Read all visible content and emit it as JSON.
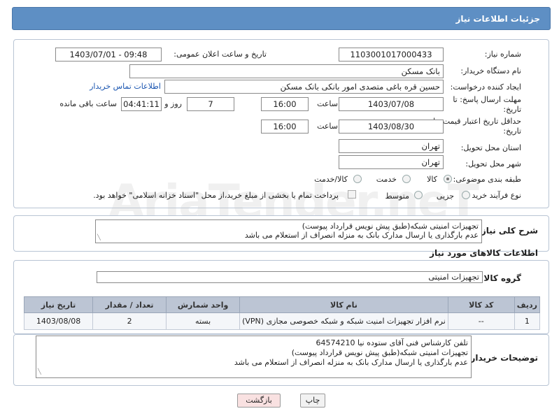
{
  "header": {
    "title": "جزئیات اطلاعات نیاز"
  },
  "form": {
    "need_number_label": "شماره نیاز:",
    "need_number": "1103001017000433",
    "announce_label": "تاریخ و ساعت اعلان عمومی:",
    "announce_value": "1403/07/01 - 09:48",
    "buyer_org_label": "نام دستگاه خریدار:",
    "buyer_org": "بانک مسکن",
    "creator_label": "ایجاد کننده درخواست:",
    "creator": "حسین  قره باغی متصدی امور بانکی بانک مسکن",
    "contact_link": "اطلاعات تماس خریدار",
    "reply_deadline_label": "مهلت ارسال پاسخ: تا تاریخ:",
    "reply_date": "1403/07/08",
    "time_label": "ساعت",
    "reply_time": "16:00",
    "days_value": "7",
    "days_label": "روز و",
    "remaining_value": "04:41:11",
    "remaining_label": "ساعت باقی مانده",
    "validity_label": "حداقل تاریخ اعتبار قیمت: تا تاریخ:",
    "validity_date": "1403/08/30",
    "validity_time": "16:00",
    "province_label": "استان محل تحویل:",
    "province": "تهران",
    "city_label": "شهر محل تحویل:",
    "city": "تهران",
    "category_label": "طبقه بندی موضوعی:",
    "category_options": [
      "کالا",
      "خدمت",
      "کالا/خدمت"
    ],
    "process_label": "نوع فرآیند خرید :",
    "process_options": [
      "جزیی",
      "متوسط"
    ],
    "payment_note": "پرداخت تمام یا بخشی از مبلغ خرید،از محل \"اسناد خزانه اسلامی\" خواهد بود."
  },
  "description": {
    "label": "شرح کلی نیاز:",
    "lines": [
      "تجهیزات امنیتی شبکه(طبق پیش نویس قرارداد پیوست)",
      "عدم بارگذاری یا ارسال مدارک بانک به منزله انصراف از استعلام می باشد"
    ]
  },
  "goods": {
    "section_title": "اطلاعات کالاهای مورد نیاز",
    "group_label": "گروه کالا:",
    "group_value": "تجهیزات امنیتی",
    "columns": [
      "ردیف",
      "کد کالا",
      "نام کالا",
      "واحد شمارش",
      "تعداد / مقدار",
      "تاریخ نیاز"
    ],
    "rows": [
      {
        "row": "1",
        "code": "--",
        "name": "نرم افزار تجهیزات امنیت شبکه و شبکه خصوصی مجازی (VPN)",
        "unit": "بسته",
        "qty": "2",
        "date": "1403/08/08"
      }
    ]
  },
  "buyer_notes": {
    "label": "توضیحات خریدار:",
    "lines": [
      "تلفن کارشناس فنی آقای ستوده نیا 64574210",
      "تجهیزات امنیتی شبکه(طبق پیش نویس قرارداد پیوست)",
      "عدم بارگذاری یا ارسال مدارک بانک به منزله انصراف از استعلام می باشد"
    ]
  },
  "buttons": {
    "print": "چاپ",
    "back": "بازگشت"
  },
  "watermark": "AriaTender.neT",
  "colors": {
    "header": "#5e8fc4",
    "link": "#1a55b0",
    "back_button": "#f9e1e1"
  }
}
